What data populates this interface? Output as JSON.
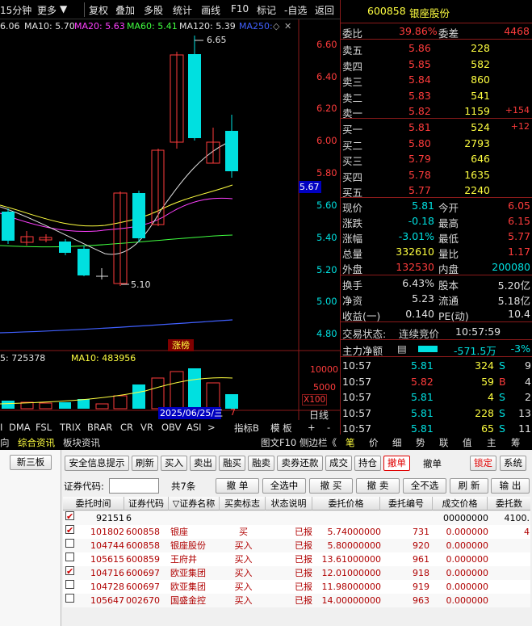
{
  "toolbar": {
    "period": "15分钟",
    "more": "更多",
    "items": [
      "复权",
      "叠加",
      "多股",
      "统计",
      "画线",
      "F10",
      "标记",
      "-自选",
      "返回"
    ]
  },
  "ma": {
    "ma5": "6.06",
    "ma10": "MA10: 5.70",
    "ma20": "MA20: 5.63",
    "ma60": "MA60: 5.41",
    "ma120": "MA120: 5.39",
    "ma250": "MA250: "
  },
  "price_axis": [
    "6.60",
    "6.40",
    "6.20",
    "6.00",
    "5.80",
    "5.60",
    "5.40",
    "5.20",
    "5.00",
    "4.80"
  ],
  "cur_price_tag": "5.67",
  "annot": {
    "high": "6.65",
    "low": "5.10",
    "zhangbang": "涨榜"
  },
  "vol": {
    "label1": "5: 725378",
    "label2": "MA10: 483956",
    "axis": [
      "10000",
      "5000",
      "X100"
    ],
    "date": "2025/06/25/三",
    "date_suffix": "7",
    "ricu": "日线"
  },
  "ind_tabs": [
    "I",
    "DMA",
    "FSL",
    "TRIX",
    "BRAR",
    "CR",
    "VR",
    "OBV",
    "ASI",
    ">",
    "指标B",
    "模 板",
    "+",
    "-"
  ],
  "nav_left": [
    "向",
    "综合资讯",
    "板块资讯"
  ],
  "nav_mid": [
    "图文F10",
    "侧边栏《"
  ],
  "nav_right": [
    "笔",
    "价",
    "细",
    "势",
    "联",
    "值",
    "主",
    "筹"
  ],
  "quote": {
    "code": "600858",
    "name": "银座股份",
    "weibi_lbl": "委比",
    "weibi": "39.86%",
    "weicha_lbl": "委差",
    "weicha": "4468",
    "sell": [
      {
        "l": "卖五",
        "p": "5.86",
        "v": "228",
        "d": ""
      },
      {
        "l": "卖四",
        "p": "5.85",
        "v": "582",
        "d": ""
      },
      {
        "l": "卖三",
        "p": "5.84",
        "v": "860",
        "d": ""
      },
      {
        "l": "卖二",
        "p": "5.83",
        "v": "541",
        "d": ""
      },
      {
        "l": "卖一",
        "p": "5.82",
        "v": "1159",
        "d": "+154"
      }
    ],
    "buy": [
      {
        "l": "买一",
        "p": "5.81",
        "v": "524",
        "d": "+12"
      },
      {
        "l": "买二",
        "p": "5.80",
        "v": "2793",
        "d": ""
      },
      {
        "l": "买三",
        "p": "5.79",
        "v": "646",
        "d": ""
      },
      {
        "l": "买四",
        "p": "5.78",
        "v": "1635",
        "d": ""
      },
      {
        "l": "买五",
        "p": "5.77",
        "v": "2240",
        "d": ""
      }
    ],
    "stats": [
      {
        "l1": "现价",
        "v1": "5.81",
        "l2": "今开",
        "v2": "6.05"
      },
      {
        "l1": "涨跌",
        "v1": "-0.18",
        "l2": "最高",
        "v2": "6.15"
      },
      {
        "l1": "涨幅",
        "v1": "-3.01%",
        "l2": "最低",
        "v2": "5.77"
      },
      {
        "l1": "总量",
        "v1": "332610",
        "l2": "量比",
        "v2": "1.17"
      },
      {
        "l1": "外盘",
        "v1": "132530",
        "l2": "内盘",
        "v2": "200080"
      }
    ],
    "stats2": [
      {
        "l1": "换手",
        "v1": "6.43%",
        "l2": "股本",
        "v2": "5.20亿"
      },
      {
        "l1": "净资",
        "v1": "5.23",
        "l2": "流通",
        "v2": "5.18亿"
      },
      {
        "l1": "收益(一)",
        "v1": "0.140",
        "l2": "PE(动)",
        "v2": "10.4"
      }
    ],
    "state_lbl": "交易状态:",
    "state": "连续竞价",
    "state_time": "10:57:59",
    "main_lbl": "主力净额",
    "main_val": "-571.5万",
    "main_pct": "-3%",
    "ticks": [
      {
        "t": "10:57",
        "p": "5.81",
        "v": "324",
        "s": "S",
        "n": "9"
      },
      {
        "t": "10:57",
        "p": "5.82",
        "v": "59",
        "s": "B",
        "n": "4"
      },
      {
        "t": "10:57",
        "p": "5.81",
        "v": "4",
        "s": "S",
        "n": "2"
      },
      {
        "t": "10:57",
        "p": "5.81",
        "v": "228",
        "s": "S",
        "n": "13"
      },
      {
        "t": "10:57",
        "p": "5.81",
        "v": "65",
        "s": "S",
        "n": "11"
      }
    ]
  },
  "bottom": {
    "side_btn": "新三板",
    "buttons": [
      "安全信息提示",
      "刷新",
      "买入",
      "卖出",
      "融买",
      "融卖",
      "卖券还款",
      "成交",
      "持仓",
      "撤单",
      "撤单",
      "锁定",
      "系统"
    ],
    "code_lbl": "证券代码:",
    "count": "共7条",
    "actions": [
      "撤 单",
      "全选中",
      "撤 买",
      "撤 卖",
      "全不选",
      "刷 新",
      "输 出"
    ],
    "headers": [
      "委托时间",
      "证券代码",
      "▽证券名称",
      "买卖标志",
      "状态说明",
      "委托价格",
      "委托编号",
      "成交价格",
      "委托数"
    ],
    "rows": [
      {
        "chk": true,
        "time": "92151",
        "code": "6",
        "name": "",
        "side": "",
        "st": "",
        "price": "",
        "no": "",
        "deal": "00000000",
        "qty": "4100.",
        "black": true
      },
      {
        "chk": true,
        "time": "101802",
        "code": "600858",
        "name": "银座",
        "side": "买",
        "st": "已报",
        "price": "5.74000000",
        "no": "731",
        "deal": "0.000000",
        "qty": "4"
      },
      {
        "chk": false,
        "time": "104744",
        "code": "600858",
        "name": "银座股份",
        "side": "买入",
        "st": "已报",
        "price": "5.80000000",
        "no": "920",
        "deal": "0.000000",
        "qty": ""
      },
      {
        "chk": false,
        "time": "105615",
        "code": "600859",
        "name": "王府井",
        "side": "买入",
        "st": "已报",
        "price": "13.61000000",
        "no": "961",
        "deal": "0.000000",
        "qty": ""
      },
      {
        "chk": true,
        "time": "104716",
        "code": "600697",
        "name": "欧亚集团",
        "side": "买入",
        "st": "已报",
        "price": "12.01000000",
        "no": "918",
        "deal": "0.000000",
        "qty": ""
      },
      {
        "chk": false,
        "time": "104728",
        "code": "600697",
        "name": "欧亚集团",
        "side": "买入",
        "st": "已报",
        "price": "11.98000000",
        "no": "919",
        "deal": "0.000000",
        "qty": ""
      },
      {
        "chk": false,
        "time": "105647",
        "code": "002670",
        "name": "国盛金控",
        "side": "买入",
        "st": "已报",
        "price": "14.00000000",
        "no": "963",
        "deal": "0.000000",
        "qty": ""
      }
    ]
  },
  "colors": {
    "up": "#ff3c3c",
    "down": "#00e0e0",
    "grid": "#8a1a1a",
    "bg": "#000000"
  }
}
